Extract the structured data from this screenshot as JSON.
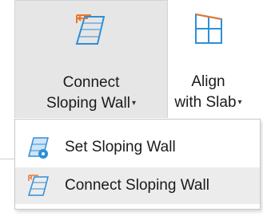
{
  "ribbon": {
    "connect_sloping_wall": {
      "label_line1": "Connect",
      "label_line2": "Sloping Wall",
      "icon": "connect-sloping-wall-icon"
    },
    "align_with_slab": {
      "label_line1": "Align",
      "label_line2": "with Slab",
      "icon": "align-with-slab-icon"
    },
    "dropdown_caret": "▾"
  },
  "dropdown": {
    "items": [
      {
        "label": "Set Sloping Wall",
        "icon": "set-sloping-wall-icon"
      },
      {
        "label": "Connect Sloping Wall",
        "icon": "connect-sloping-wall-icon",
        "highlighted": true
      }
    ]
  },
  "colors": {
    "icon_blue": "#2e8fd8",
    "icon_orange": "#e8762b",
    "hover_bg": "#e6e6e6"
  }
}
